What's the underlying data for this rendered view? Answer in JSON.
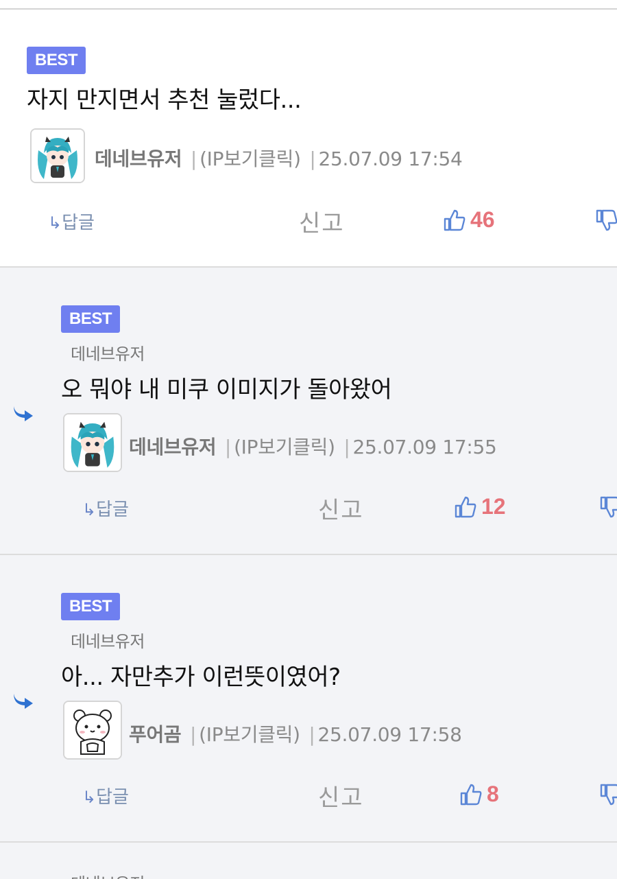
{
  "comments": [
    {
      "badge": "BEST",
      "reply_to": "",
      "content": "자지 만지면서 추천 눌렀다...",
      "nickname": "데네브유저",
      "ip": "(IP보기클릭)",
      "datetime": "25.07.09 17:54",
      "avatar": "miku-avatar",
      "reply_label": "답글",
      "report_label": "신고",
      "likes": "46"
    },
    {
      "badge": "BEST",
      "reply_to": "데네브유저",
      "content": "오 뭐야 내 미쿠 이미지가 돌아왔어",
      "nickname": "데네브유저",
      "ip": "(IP보기클릭)",
      "datetime": "25.07.09 17:55",
      "avatar": "miku-avatar",
      "reply_label": "답글",
      "report_label": "신고",
      "likes": "12"
    },
    {
      "badge": "BEST",
      "reply_to": "데네브유저",
      "content": "아... 자만추가 이런뜻이였어?",
      "nickname": "푸어곰",
      "ip": "(IP보기클릭)",
      "datetime": "25.07.09 17:58",
      "avatar": "bear-avatar",
      "reply_label": "답글",
      "report_label": "신고",
      "likes": "8"
    },
    {
      "reply_to": "데네브유저"
    }
  ],
  "separator": "|",
  "colors": {
    "best_badge": "#6f7ff0",
    "reply_bg": "#f3f4f7",
    "like_count": "#e6737a",
    "thumb_icon": "#5b86d6",
    "reply_arrow": "#2f72d1"
  }
}
